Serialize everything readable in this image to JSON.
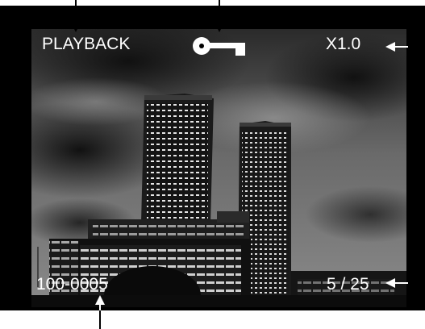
{
  "display": {
    "mode_label": "PLAYBACK",
    "zoom_label": "X1.0",
    "frame_counter": "5 / 25",
    "file_number": "100-0005",
    "lock_icon": "key-lock-icon"
  },
  "colors": {
    "background": "#000000",
    "osd_text": "#ffffff",
    "callout": "#000000"
  }
}
